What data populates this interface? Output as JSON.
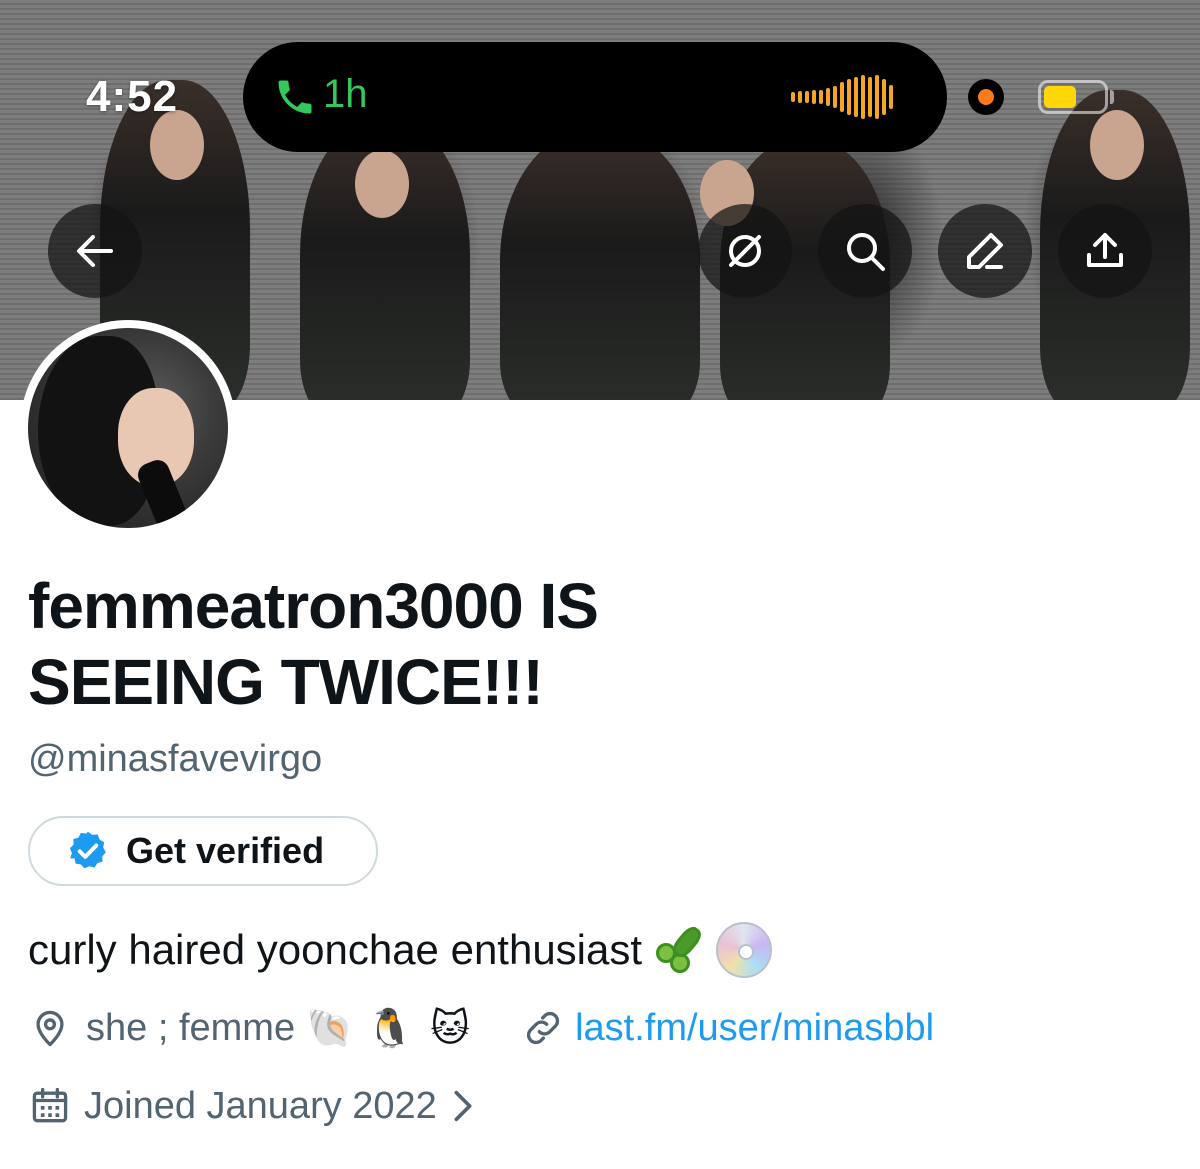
{
  "status_bar": {
    "time": "4:52",
    "call_duration": "1h",
    "call_icon": "phone-icon",
    "waveform_icon": "audio-waveform-icon",
    "recording_indicator_color": "#ff7a1a",
    "battery_color": "#ffd60a",
    "battery_level": 0.55
  },
  "header": {
    "back_icon": "back-arrow-icon",
    "actions": [
      "grok-icon",
      "search-icon",
      "edit-icon",
      "share-icon"
    ]
  },
  "profile": {
    "display_name": "femmeatron3000 IS SEEING TWICE!!!",
    "handle": "@minasfavevirgo",
    "verify_button_label": "Get verified",
    "verify_icon": "verified-badge-icon",
    "bio": "curly haired yoonchae enthusiast",
    "bio_emojis": [
      "cucumber-emoji",
      "optical-disc-emoji"
    ],
    "location": "she ; femme",
    "location_emojis": [
      "🐚",
      "🐧",
      "🐱"
    ],
    "link": "last.fm/user/minasbbl",
    "joined": "Joined January 2022"
  },
  "colors": {
    "accent": "#1d9bf0",
    "muted": "#536471",
    "text": "#0f1419",
    "call_green": "#34c759"
  }
}
